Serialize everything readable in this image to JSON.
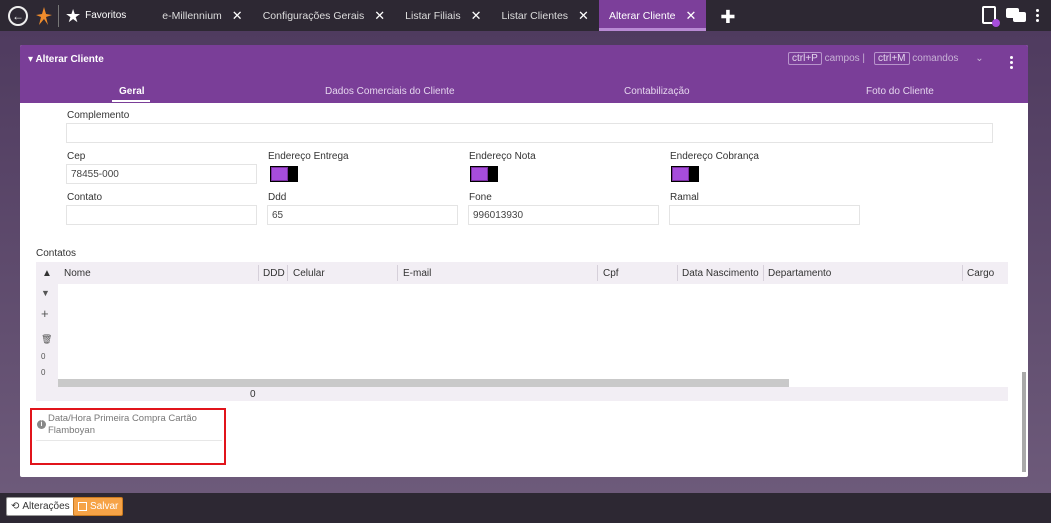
{
  "topbar": {
    "favorites": "Favoritos",
    "tabs": [
      {
        "label": "e-Millennium",
        "active": false
      },
      {
        "label": "Configurações Gerais",
        "active": false
      },
      {
        "label": "Listar Filiais",
        "active": false
      },
      {
        "label": "Listar Clientes",
        "active": false
      },
      {
        "label": "Alterar Cliente",
        "active": true
      }
    ],
    "icons": {
      "back": "arrow-left-icon",
      "logo": "millennium-logo-icon",
      "star": "star-icon",
      "add": "plus-icon",
      "tasks": "clipboard-check-icon",
      "chat": "chat-icon",
      "menu": "vertical-dots-icon"
    }
  },
  "card": {
    "title": "Alterar Cliente",
    "shortcuts": {
      "fields_key": "ctrl+P",
      "fields_label": "campos",
      "commands_key": "ctrl+M",
      "commands_label": "comandos",
      "separator": "|"
    },
    "tabs": [
      "Geral",
      "Dados Comerciais do Cliente",
      "Contabilização",
      "Foto do Cliente"
    ]
  },
  "form": {
    "complemento": {
      "label": "Complemento",
      "value": ""
    },
    "cep": {
      "label": "Cep",
      "value": "78455-000"
    },
    "endereco_entrega": {
      "label": "Endereço Entrega"
    },
    "endereco_nota": {
      "label": "Endereço Nota"
    },
    "endereco_cobranca": {
      "label": "Endereço Cobrança"
    },
    "contato": {
      "label": "Contato",
      "value": ""
    },
    "ddd": {
      "label": "Ddd",
      "value": "65"
    },
    "fone": {
      "label": "Fone",
      "value": "996013930"
    },
    "ramal": {
      "label": "Ramal",
      "value": ""
    }
  },
  "contacts": {
    "label": "Contatos",
    "columns": [
      "Nome",
      "DDD",
      "Celular",
      "E-mail",
      "Cpf",
      "Data Nascimento",
      "Departamento",
      "Cargo"
    ],
    "side_counts": [
      "0",
      "0"
    ],
    "footer_count": "0"
  },
  "highlight": {
    "label": "Data/Hora Primeira Compra Cartão Flamboyan",
    "value": ""
  },
  "bottombar": {
    "changes": "Alterações",
    "save": "Salvar"
  },
  "colors": {
    "accent": "#7a3e98",
    "toggle": "#a64ddb",
    "save": "#f6a347",
    "highlight_border": "#e1141b"
  }
}
